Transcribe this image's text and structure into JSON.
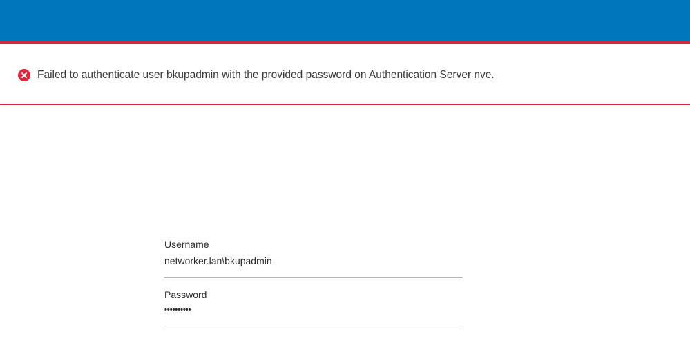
{
  "header": {
    "brand_color": "#0077bd",
    "accent_color": "#d7263d"
  },
  "alert": {
    "icon": "error-circle-icon",
    "message": "Failed to authenticate user bkupadmin with the provided password on Authentication Server nve.",
    "color": "#e0283c"
  },
  "login": {
    "username_label": "Username",
    "username_value": "networker.lan\\bkupadmin",
    "password_label": "Password",
    "password_value": "••••••••••"
  }
}
